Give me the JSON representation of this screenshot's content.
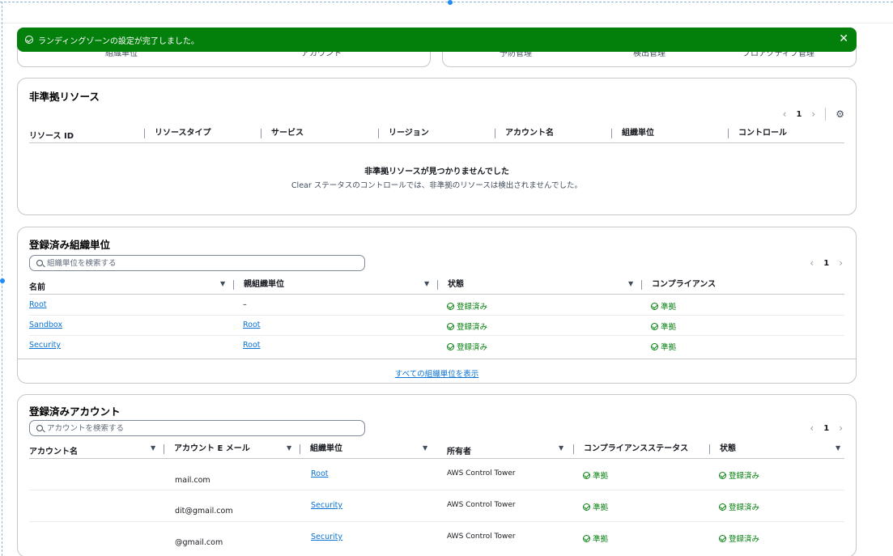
{
  "flash": {
    "message": "ランディングゾーンの設定が完了しました。",
    "close": "✕"
  },
  "top_cards": {
    "left": [
      "組織単位",
      "アカウント"
    ],
    "right": [
      "予防管理",
      "検出管理",
      "プロアクティブ管理"
    ]
  },
  "noncompliant": {
    "title": "非準拠リソース",
    "page": "1",
    "columns": [
      "リソース ID",
      "リソースタイプ",
      "サービス",
      "リージョン",
      "アカウント名",
      "組織単位",
      "コントロール"
    ],
    "empty_title": "非準拠リソースが見つかりませんでした",
    "empty_sub": "Clear ステータスのコントロールでは、非準拠のリソースは検出されませんでした。"
  },
  "ous": {
    "title": "登録済み組織単位",
    "search_placeholder": "組織単位を検索する",
    "page": "1",
    "columns": [
      "名前",
      "親組織単位",
      "状態",
      "コンプライアンス"
    ],
    "rows": [
      {
        "name": "Root",
        "parent": "–",
        "state": "登録済み",
        "compliance": "準拠"
      },
      {
        "name": "Sandbox",
        "parent": "Root",
        "state": "登録済み",
        "compliance": "準拠"
      },
      {
        "name": "Security",
        "parent": "Root",
        "state": "登録済み",
        "compliance": "準拠"
      }
    ],
    "view_all": "すべての組織単位を表示"
  },
  "accounts": {
    "title": "登録済みアカウント",
    "search_placeholder": "アカウントを検索する",
    "page": "1",
    "columns": [
      "アカウント名",
      "アカウント E メール",
      "組織単位",
      "所有者",
      "コンプライアンスステータス",
      "状態"
    ],
    "rows": [
      {
        "name": "",
        "email": "mail.com",
        "ou": "Root",
        "owner": "AWS Control Tower",
        "compliance": "準拠",
        "state": "登録済み"
      },
      {
        "name": "",
        "email": "dit@gmail.com",
        "ou": "Security",
        "owner": "AWS Control Tower",
        "compliance": "準拠",
        "state": "登録済み"
      },
      {
        "name": "",
        "email": "@gmail.com",
        "ou": "Security",
        "owner": "AWS Control Tower",
        "compliance": "準拠",
        "state": "登録済み"
      }
    ]
  },
  "colors": {
    "success": "#037f0c",
    "link": "#0972d3",
    "border": "#c6c6cd"
  },
  "icons": [
    "success-check-icon",
    "close-icon",
    "search-icon",
    "gear-icon",
    "chevron-left-icon",
    "chevron-right-icon",
    "sort-caret-icon"
  ]
}
